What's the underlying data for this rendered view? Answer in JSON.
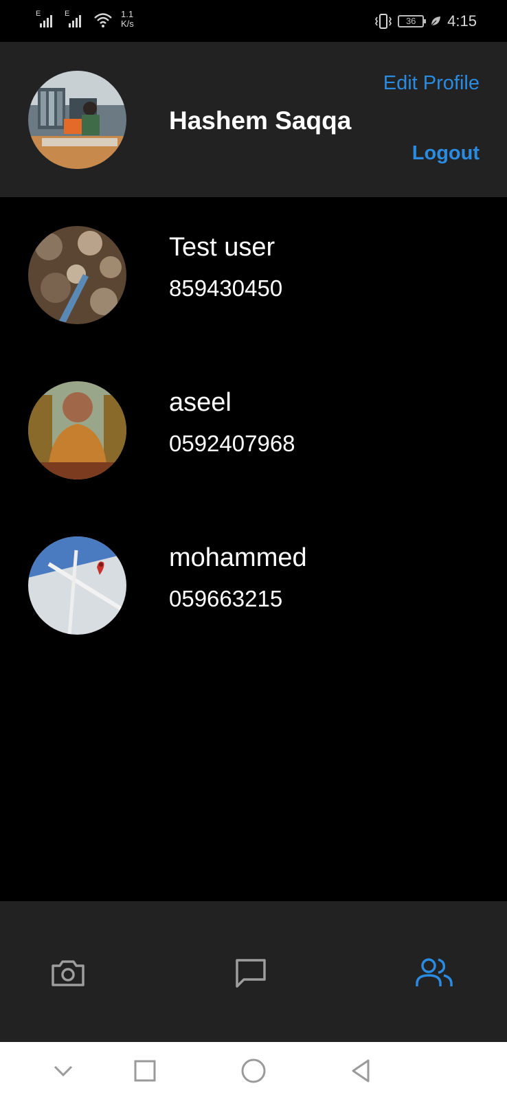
{
  "status_bar": {
    "net_type_1": "E",
    "net_type_2": "E",
    "speed_value": "1.1",
    "speed_unit": "K/s",
    "battery_level": "36",
    "time": "4:15",
    "icons": [
      "signal-icon",
      "signal-icon",
      "wifi-icon",
      "vibrate-icon",
      "battery-icon",
      "leaf-icon"
    ]
  },
  "profile": {
    "name": "Hashem Saqqa",
    "edit_label": "Edit Profile",
    "logout_label": "Logout"
  },
  "contacts": [
    {
      "name": "Test user",
      "phone": "859430450"
    },
    {
      "name": "aseel",
      "phone": "0592407968"
    },
    {
      "name": "mohammed",
      "phone": "059663215"
    }
  ],
  "bottom_nav": {
    "items": [
      "camera-icon",
      "chat-icon",
      "users-icon"
    ],
    "active": "users-icon"
  },
  "system_nav": {
    "items": [
      "collapse-icon",
      "recents-icon",
      "home-icon",
      "back-icon"
    ]
  },
  "colors": {
    "accent": "#2a8be0",
    "header_bg": "#222222",
    "page_bg": "#000000",
    "inactive_icon": "#9e9e9e"
  }
}
